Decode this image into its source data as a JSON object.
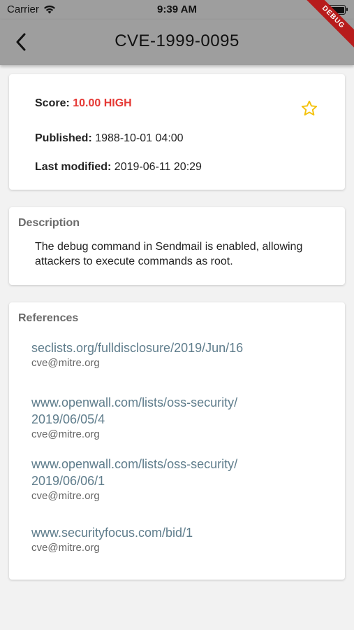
{
  "status_bar": {
    "carrier": "Carrier",
    "time": "9:39 AM"
  },
  "app_bar": {
    "title": "CVE-1999-0095",
    "debug_banner": "DEBUG",
    "back_icon": "chevron-left-icon"
  },
  "summary": {
    "score_label": "Score:",
    "score_value": "10.00 HIGH",
    "score_color": "#e53935",
    "published_label": "Published:",
    "published_value": "1988-10-01 04:00",
    "modified_label": "Last modified:",
    "modified_value": "2019-06-11 20:29",
    "favorite_icon": "star-outline-icon",
    "favorite_color": "#f4c20d"
  },
  "description": {
    "heading": "Description",
    "text": "The debug command in Sendmail is enabled, allowing attackers to execute commands as root."
  },
  "references": {
    "heading": "References",
    "items": [
      {
        "url": "seclists.org/fulldisclosure/2019/Jun/16",
        "source": "cve@mitre.org"
      },
      {
        "url": "www.openwall.com/lists/oss-security/\n2019/06/05/4",
        "source": "cve@mitre.org"
      },
      {
        "url": "www.openwall.com/lists/oss-security/\n2019/06/06/1",
        "source": "cve@mitre.org"
      },
      {
        "url": "www.securityfocus.com/bid/1",
        "source": "cve@mitre.org"
      }
    ]
  },
  "colors": {
    "app_bar": "#9e9e9e",
    "link": "#5f7d8c",
    "background": "#f2f2f2"
  }
}
